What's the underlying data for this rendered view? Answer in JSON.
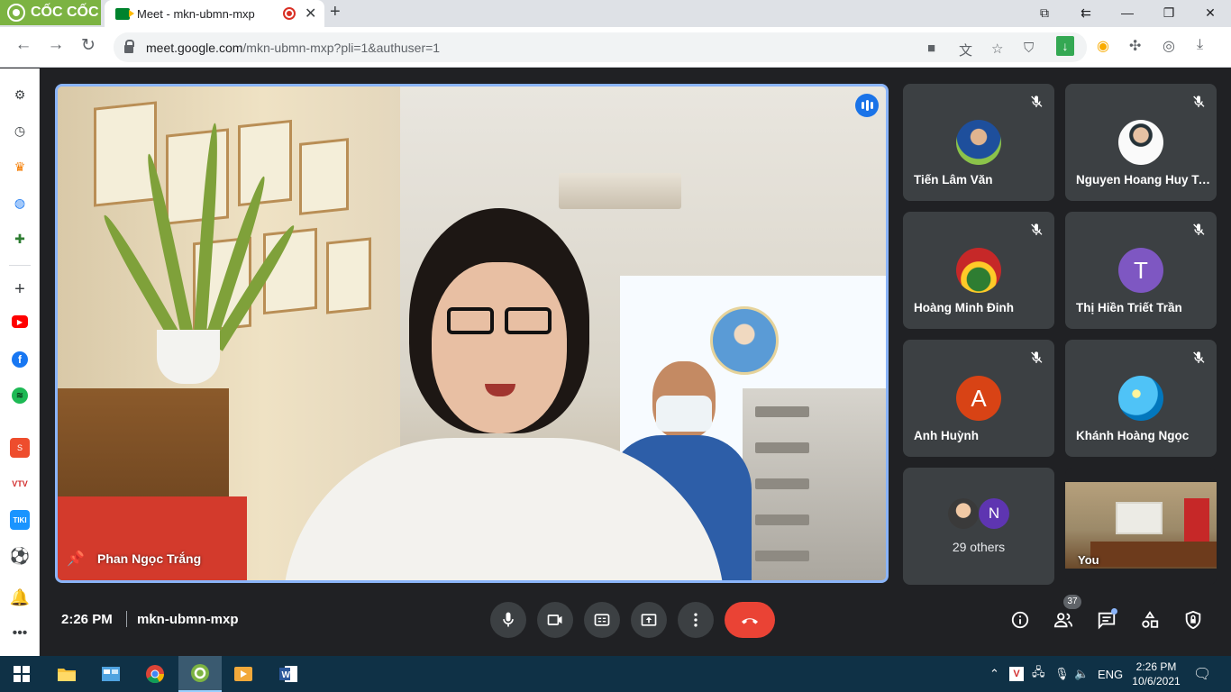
{
  "browser": {
    "brand_name": "CỐC CỐC",
    "tab_title": "Meet - mkn-ubmn-mxp",
    "url_host": "meet.google.com",
    "url_path": "/mkn-ubmn-mxp?pli=1&authuser=1"
  },
  "main_tile": {
    "name": "Phan Ngọc Trắng"
  },
  "participants": [
    {
      "name": "Tiến Lâm Văn",
      "avatar_type": "photo",
      "avatar_color": "#2e7d32"
    },
    {
      "name": "Nguyen Hoang Huy Tung",
      "avatar_type": "photo",
      "avatar_color": "#eceff1"
    },
    {
      "name": "Hoàng Minh Đinh",
      "avatar_type": "photo",
      "avatar_color": "#c62828"
    },
    {
      "name": "Thị Hiền Triết Trần",
      "avatar_type": "letter",
      "avatar_letter": "T",
      "avatar_color": "#7e57c2"
    },
    {
      "name": "Anh Huỳnh",
      "avatar_type": "letter",
      "avatar_letter": "A",
      "avatar_color": "#d84315"
    },
    {
      "name": "Khánh Hoàng Ngọc",
      "avatar_type": "photo",
      "avatar_color": "#4fc3f7"
    }
  ],
  "others_tile": {
    "label": "29 others",
    "avatar_letter": "N",
    "avatar_color": "#5e35b1"
  },
  "self_tile": {
    "name": "You"
  },
  "meeting": {
    "time": "2:26 PM",
    "code": "mkn-ubmn-mxp",
    "participant_count": "37"
  },
  "taskbar": {
    "language": "ENG",
    "clock_time": "2:26 PM",
    "clock_date": "10/6/2021"
  },
  "colors": {
    "accent": "#8ab4f8",
    "leave": "#ea4335",
    "tile_bg": "#3c4043"
  }
}
